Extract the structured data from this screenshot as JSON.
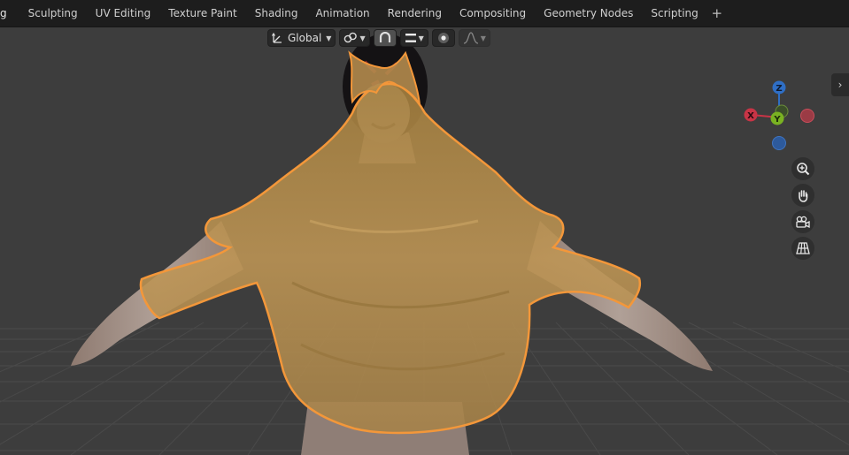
{
  "workspace_tabs": [
    {
      "label": "g"
    },
    {
      "label": "Sculpting"
    },
    {
      "label": "UV Editing"
    },
    {
      "label": "Texture Paint"
    },
    {
      "label": "Shading"
    },
    {
      "label": "Animation"
    },
    {
      "label": "Rendering"
    },
    {
      "label": "Compositing"
    },
    {
      "label": "Geometry Nodes"
    },
    {
      "label": "Scripting"
    }
  ],
  "add_tab_label": "+",
  "header": {
    "transform_orientation": {
      "label": "Global",
      "icon": "transform-orientation-icon"
    },
    "pivot": {
      "icon": "pivot-link-icon"
    },
    "snap": {
      "icon": "snap-magnet-icon",
      "active": true
    },
    "snap_target": {
      "icon": "snap-increment-icon"
    },
    "proportional": {
      "icon": "proportional-edit-icon"
    },
    "falloff": {
      "icon": "falloff-curve-icon",
      "enabled": false
    }
  },
  "sidebar_toggle_glyph": "›",
  "gizmo": {
    "labels": {
      "x": "X",
      "y": "Y",
      "z": "Z"
    },
    "colors": {
      "x": "#c83446",
      "y": "#7ab222",
      "z": "#2f6fc6"
    }
  },
  "viewport_buttons": [
    {
      "name": "zoom",
      "icon": "zoom-magnifier-icon"
    },
    {
      "name": "pan",
      "icon": "hand-icon"
    },
    {
      "name": "camera",
      "icon": "camera-view-icon"
    },
    {
      "name": "perspective",
      "icon": "grid-perspective-icon"
    }
  ],
  "colors": {
    "viewport_bg": "#3d3d3d",
    "tabbar_bg": "#1d1d1d",
    "selection_outline": "#f3973a",
    "cloth": "#b8904e"
  }
}
